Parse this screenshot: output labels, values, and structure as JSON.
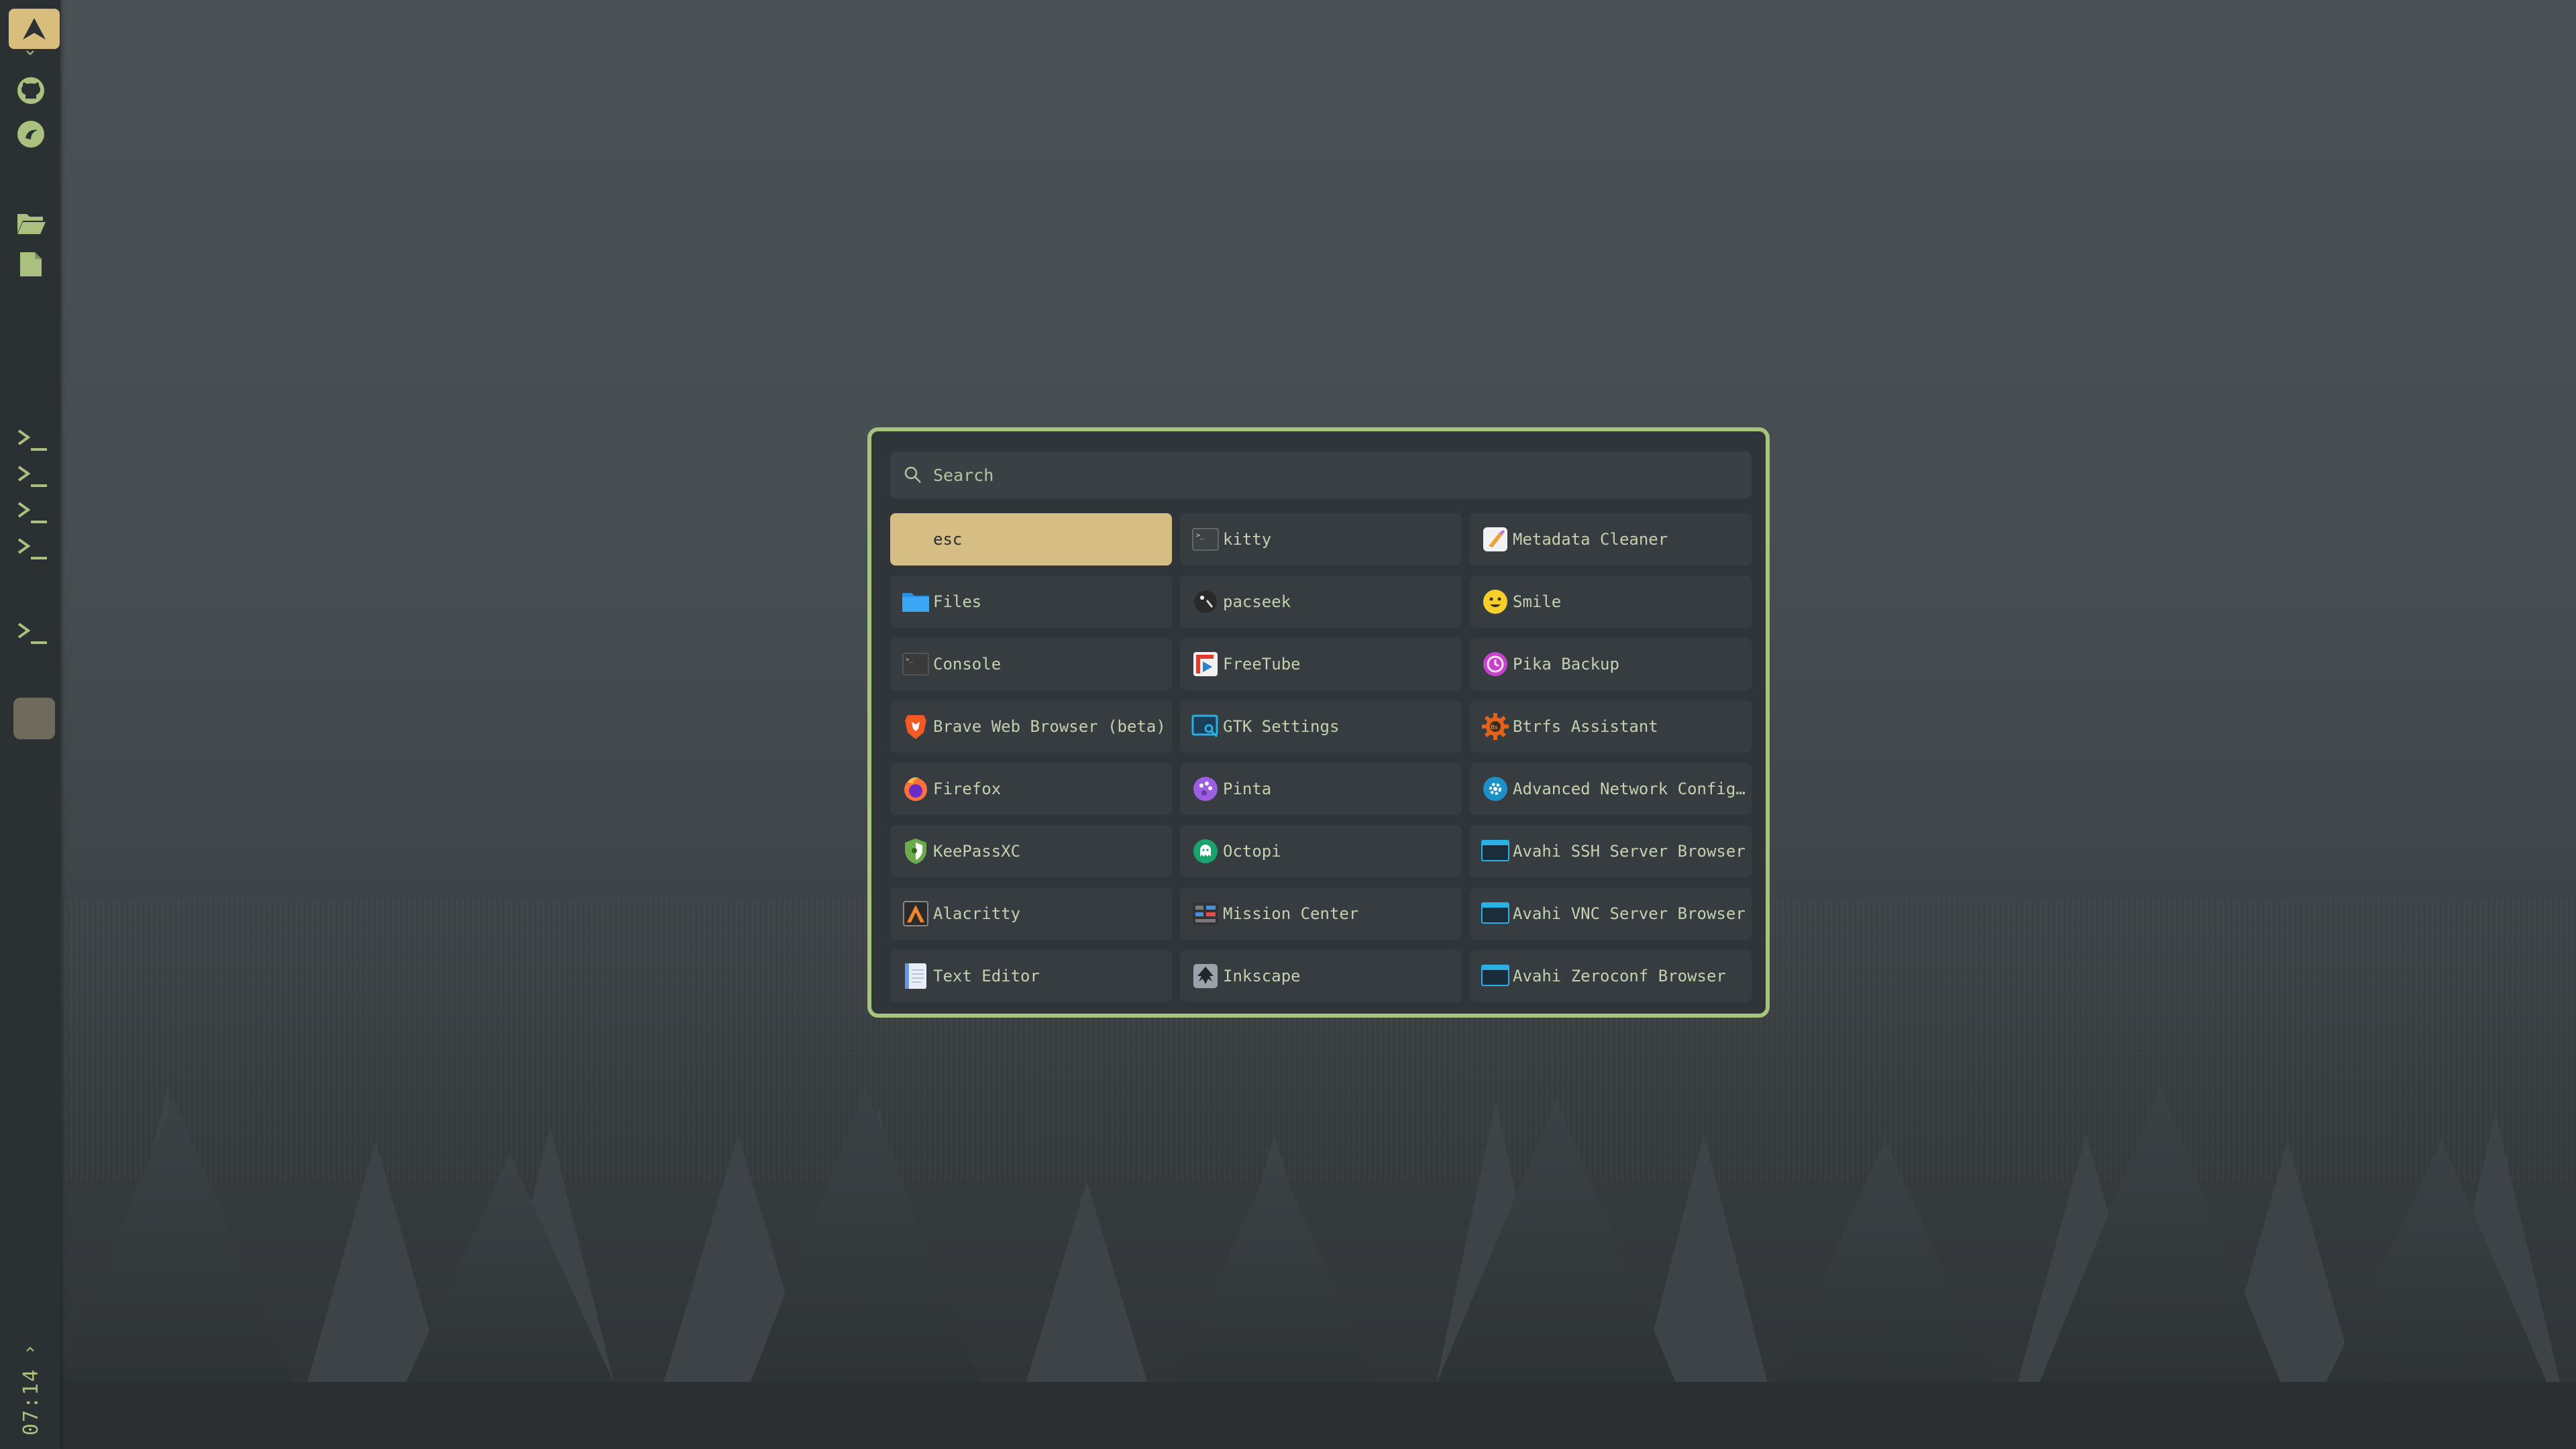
{
  "sidebar": {
    "items": [
      {
        "name": "launcher-logo-icon"
      },
      {
        "name": "github-icon"
      },
      {
        "name": "app-circle-icon"
      },
      {
        "name": "folder-open-icon"
      },
      {
        "name": "document-icon"
      },
      {
        "name": "terminal-icon"
      },
      {
        "name": "terminal-icon"
      },
      {
        "name": "terminal-icon"
      },
      {
        "name": "terminal-icon"
      },
      {
        "name": "terminal-icon"
      }
    ],
    "clock": "07:14",
    "accent": "#a9c07e"
  },
  "launcher": {
    "search_placeholder": "Search",
    "border_color": "#a6c47d",
    "selected_color": "#d6bd84",
    "items": [
      {
        "label": "esc",
        "icon": "none"
      },
      {
        "label": "kitty",
        "icon": "terminal-app-icon"
      },
      {
        "label": "Metadata Cleaner",
        "icon": "metadata-cleaner-icon"
      },
      {
        "label": "Files",
        "icon": "folder-icon"
      },
      {
        "label": "pacseek",
        "icon": "pacseek-icon"
      },
      {
        "label": "Smile",
        "icon": "emoji-icon"
      },
      {
        "label": "Console",
        "icon": "console-icon"
      },
      {
        "label": "FreeTube",
        "icon": "freetube-icon"
      },
      {
        "label": "Pika Backup",
        "icon": "pika-backup-icon"
      },
      {
        "label": "Brave Web Browser (beta)",
        "icon": "brave-icon"
      },
      {
        "label": "GTK Settings",
        "icon": "gtk-settings-icon"
      },
      {
        "label": "Btrfs Assistant",
        "icon": "btrfs-assistant-icon"
      },
      {
        "label": "Firefox",
        "icon": "firefox-icon"
      },
      {
        "label": "Pinta",
        "icon": "pinta-icon"
      },
      {
        "label": "Advanced Network Configu…",
        "icon": "network-config-icon"
      },
      {
        "label": "KeePassXC",
        "icon": "keepassxc-icon"
      },
      {
        "label": "Octopi",
        "icon": "octopi-icon"
      },
      {
        "label": "Avahi SSH Server Browser",
        "icon": "avahi-icon"
      },
      {
        "label": "Alacritty",
        "icon": "alacritty-icon"
      },
      {
        "label": "Mission Center",
        "icon": "mission-center-icon"
      },
      {
        "label": "Avahi VNC Server Browser",
        "icon": "avahi-icon"
      },
      {
        "label": "Text Editor",
        "icon": "text-editor-icon"
      },
      {
        "label": "Inkscape",
        "icon": "inkscape-icon"
      },
      {
        "label": "Avahi Zeroconf Browser",
        "icon": "avahi-icon"
      }
    ]
  }
}
